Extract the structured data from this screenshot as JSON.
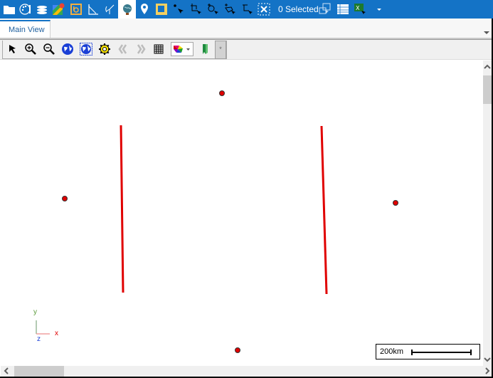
{
  "toolbar": {
    "icons": [
      {
        "name": "open-folder-icon"
      },
      {
        "name": "palette-icon"
      },
      {
        "name": "layers-icon"
      },
      {
        "name": "google-maps-icon"
      },
      {
        "name": "bing-maps-icon"
      },
      {
        "name": "measure-angle-icon"
      },
      {
        "name": "coordinate-axes-icon"
      },
      {
        "name": "globe-icon",
        "active": true
      },
      {
        "name": "map-pin-icon"
      },
      {
        "name": "draw-rectangle-icon"
      },
      {
        "name": "select-point-icon"
      },
      {
        "name": "select-rectangle-icon"
      },
      {
        "name": "select-circle-icon"
      },
      {
        "name": "select-polygon-icon"
      },
      {
        "name": "select-line-icon"
      },
      {
        "name": "clear-selection-icon"
      }
    ],
    "selected_count_label": "0 Selected",
    "right_icons": [
      {
        "name": "zoom-to-selection-icon"
      },
      {
        "name": "attribute-table-icon"
      },
      {
        "name": "export-excel-icon"
      },
      {
        "name": "overflow-dropdown-icon"
      }
    ]
  },
  "tabs": [
    {
      "label": "Main View",
      "active": true
    }
  ],
  "map_toolbar": {
    "tools": [
      {
        "name": "pointer-icon"
      },
      {
        "name": "zoom-in-icon"
      },
      {
        "name": "zoom-out-icon"
      },
      {
        "name": "full-extent-globe-icon"
      },
      {
        "name": "zoom-to-layer-globe-icon"
      },
      {
        "name": "settings-gear-icon"
      },
      {
        "name": "previous-extent-icon"
      },
      {
        "name": "next-extent-icon"
      },
      {
        "name": "grid-icon"
      },
      {
        "name": "color-scheme-dropdown-icon"
      },
      {
        "name": "bookmark-icon"
      }
    ],
    "more_label": "*"
  },
  "map": {
    "features": {
      "points": 4,
      "lines": 2
    },
    "colors": {
      "feature_fill": "#e00000",
      "accent": "#1473c6"
    },
    "axes": {
      "x": "x",
      "y": "y",
      "z": "z"
    },
    "scale_label": "200km"
  }
}
